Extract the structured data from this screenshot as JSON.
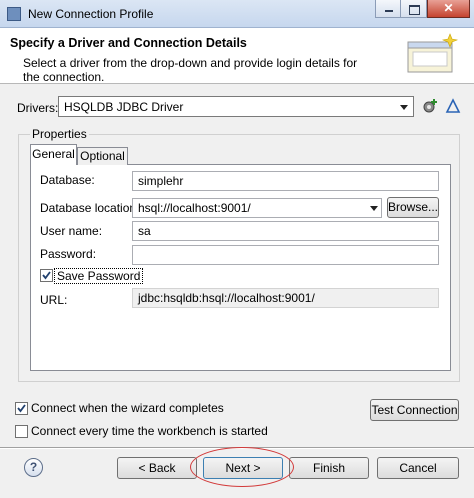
{
  "window": {
    "title": "New Connection Profile"
  },
  "header": {
    "title": "Specify a Driver and Connection Details",
    "description": "Select a driver from the drop-down and provide login details for the connection."
  },
  "drivers": {
    "label": "Drivers:",
    "selected": "HSQLDB JDBC Driver"
  },
  "properties": {
    "label": "Properties",
    "tabs": [
      {
        "label": "General"
      },
      {
        "label": "Optional"
      }
    ],
    "fields": {
      "database": {
        "label": "Database:",
        "value": "simplehr"
      },
      "database_location": {
        "label": "Database location:",
        "value": "hsql://localhost:9001/",
        "browse_label": "Browse..."
      },
      "user_name": {
        "label": "User name:",
        "value": "sa"
      },
      "password": {
        "label": "Password:",
        "value": ""
      },
      "save_password": {
        "label": "Save Password",
        "checked": true
      },
      "url": {
        "label": "URL:",
        "value": "jdbc:hsqldb:hsql://localhost:9001/"
      }
    }
  },
  "options": {
    "connect_when_wizard_completes": {
      "label": "Connect when the wizard completes",
      "checked": true
    },
    "connect_every_time": {
      "label": "Connect every time the workbench is started",
      "checked": false
    },
    "test_connection_label": "Test Connection"
  },
  "buttons": {
    "help": "?",
    "back": "< Back",
    "next": "Next >",
    "finish": "Finish",
    "cancel": "Cancel"
  },
  "colors": {
    "annotation_circle": "#d23a3a",
    "title_bar": "#c6d7ee",
    "close_button": "#c5432f"
  }
}
